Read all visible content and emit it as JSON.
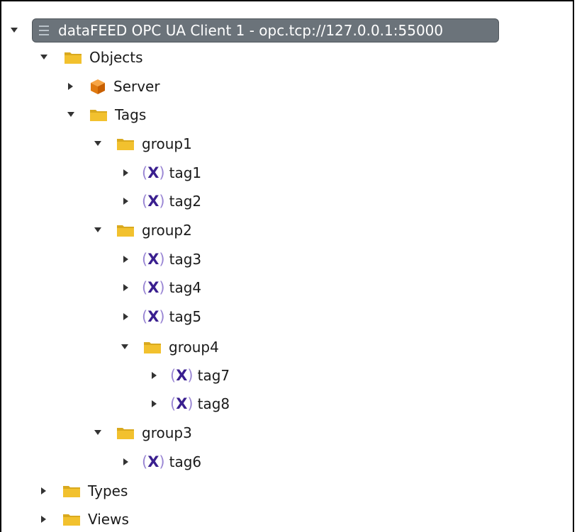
{
  "tree": {
    "root": {
      "label": "dataFEED OPC UA Client 1 - opc.tcp://127.0.0.1:55000",
      "icon": "server-list-icon",
      "expanded": true
    },
    "nodes": [
      {
        "label": "Objects",
        "icon": "folder-icon",
        "expanded": true,
        "level": 1
      },
      {
        "label": "Server",
        "icon": "object-cube-icon",
        "expanded": false,
        "level": 2
      },
      {
        "label": "Tags",
        "icon": "folder-icon",
        "expanded": true,
        "level": 2
      },
      {
        "label": "group1",
        "icon": "folder-icon",
        "expanded": true,
        "level": 3
      },
      {
        "label": "tag1",
        "icon": "variable-icon",
        "expanded": false,
        "level": 4
      },
      {
        "label": "tag2",
        "icon": "variable-icon",
        "expanded": false,
        "level": 4
      },
      {
        "label": "group2",
        "icon": "folder-icon",
        "expanded": true,
        "level": 3
      },
      {
        "label": "tag3",
        "icon": "variable-icon",
        "expanded": false,
        "level": 4
      },
      {
        "label": "tag4",
        "icon": "variable-icon",
        "expanded": false,
        "level": 4
      },
      {
        "label": "tag5",
        "icon": "variable-icon",
        "expanded": false,
        "level": 4
      },
      {
        "label": "group4",
        "icon": "folder-icon",
        "expanded": true,
        "level": 4
      },
      {
        "label": "tag7",
        "icon": "variable-icon",
        "expanded": false,
        "level": 5
      },
      {
        "label": "tag8",
        "icon": "variable-icon",
        "expanded": false,
        "level": 5
      },
      {
        "label": "group3",
        "icon": "folder-icon",
        "expanded": true,
        "level": 3
      },
      {
        "label": "tag6",
        "icon": "variable-icon",
        "expanded": false,
        "level": 4
      },
      {
        "label": "Types",
        "icon": "folder-icon",
        "expanded": false,
        "level": 1
      },
      {
        "label": "Views",
        "icon": "folder-icon",
        "expanded": false,
        "level": 1
      }
    ]
  },
  "colors": {
    "root_highlight": "#6b737a",
    "folder": "#f2c12e",
    "variable_mark": "#3a1f8f"
  }
}
